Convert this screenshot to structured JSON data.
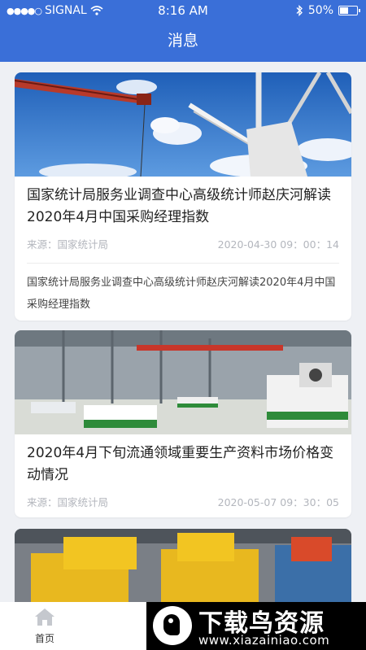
{
  "status": {
    "carrier": "SIGNAL",
    "time": "8:16 AM",
    "battery": "50%"
  },
  "nav": {
    "title": "消息"
  },
  "articles": [
    {
      "title": "国家统计局服务业调查中心高级统计师赵庆河解读2020年4月中国采购经理指数",
      "source": "来源：国家统计局",
      "datetime": "2020-04-30  09：00：14",
      "summary": "国家统计局服务业调查中心高级统计师赵庆河解读2020年4月中国采购经理指数"
    },
    {
      "title": "2020年4月下旬流通领域重要生产资料市场价格变动情况",
      "source": "来源：国家统计局",
      "datetime": "2020-05-07  09：30：05"
    }
  ],
  "tabbar": {
    "home_label": "首页"
  },
  "watermark": {
    "title": "下载鸟资源",
    "url": "www.xiazainiao.com"
  }
}
